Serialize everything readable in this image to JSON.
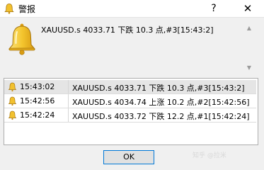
{
  "window": {
    "title": "警报",
    "help": "?",
    "close": "✕"
  },
  "alert": {
    "message": "XAUUSD.s 4033.71 下跌 10.3 点,#3[15:43:2]"
  },
  "log": {
    "rows": [
      {
        "time": "15:43:02",
        "message": "XAUUSD.s 4033.71 下跌 10.3 点,#3[15:43:2]",
        "selected": true
      },
      {
        "time": "15:42:56",
        "message": "XAUUSD.s 4034.74 上涨 10.2 点,#2[15:42:56]",
        "selected": false
      },
      {
        "time": "15:42:24",
        "message": "XAUUSD.s 4033.72 下跌 12.2 点,#1[15:42:24]",
        "selected": false
      }
    ]
  },
  "buttons": {
    "ok": "OK"
  },
  "watermark": "知乎 @拉米",
  "icons": {
    "bell": "bell-icon"
  },
  "colors": {
    "bell_gold": "#f2c12e",
    "focus_blue": "#0078d7",
    "selected_row": "#e5e5e5"
  }
}
